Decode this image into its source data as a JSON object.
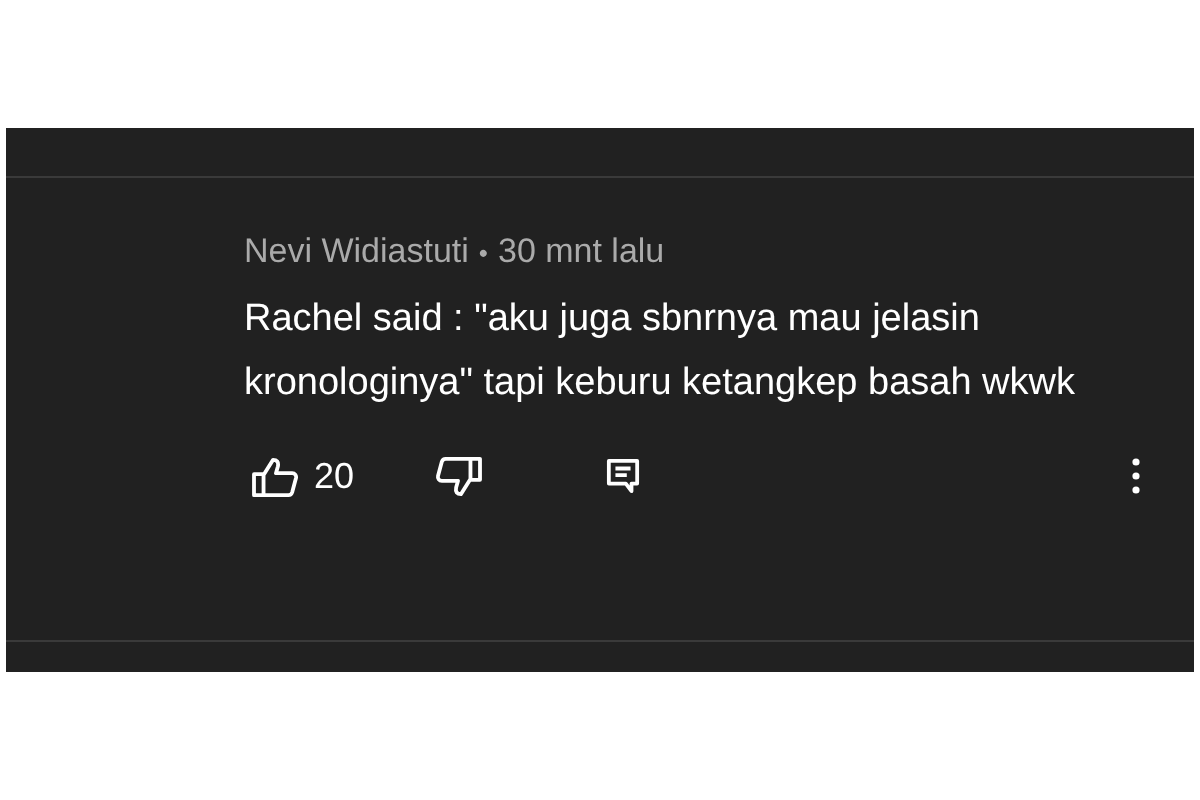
{
  "comment": {
    "author": "Nevi Widiastuti",
    "separator": "•",
    "time": "30 mnt lalu",
    "text": "Rachel said : \"aku juga sbnrnya mau jelasin kronologinya\" tapi keburu ketangkep basah wkwk",
    "like_count": "20"
  }
}
